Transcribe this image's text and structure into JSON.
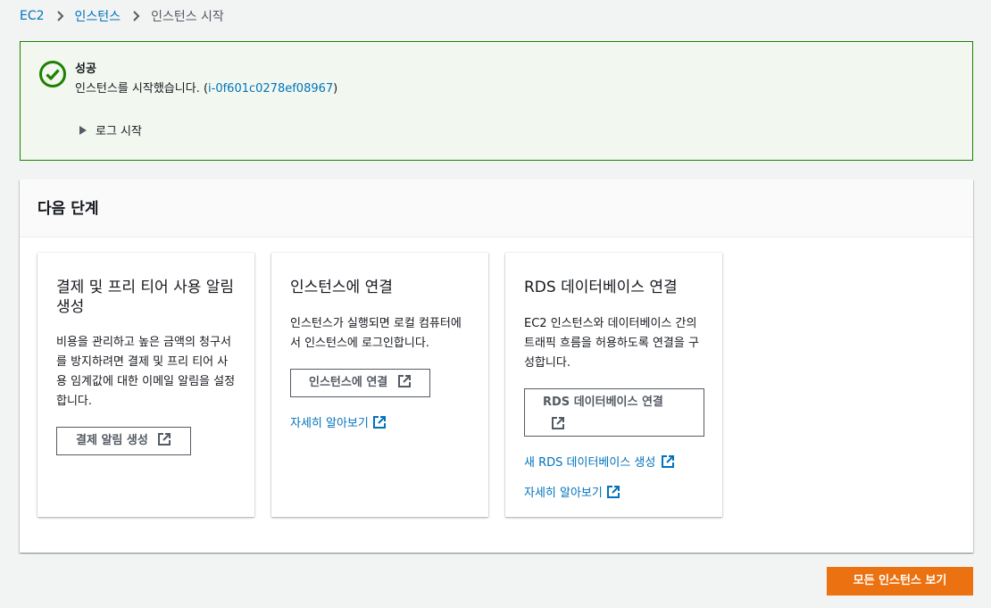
{
  "breadcrumb": {
    "items": [
      "EC2",
      "인스턴스"
    ],
    "current": "인스턴스 시작"
  },
  "alert": {
    "type": "success",
    "title": "성공",
    "message_prefix": "인스턴스를 시작했습니다. (",
    "instance_id": "i-0f601c0278ef08967",
    "message_suffix": ")",
    "log_toggle_label": "로그 시작",
    "colors": {
      "border": "#1d8102",
      "background": "#f2f8f0"
    }
  },
  "next_steps": {
    "title": "다음 단계",
    "cards": [
      {
        "title": "결제 및 프리 티어 사용 알림 생성",
        "description": "비용을 관리하고 높은 금액의 청구서를 방지하려면 결제 및 프리 티어 사용 임계값에 대한 이메일 알림을 설정합니다.",
        "button_label": "결제 알림 생성"
      },
      {
        "title": "인스턴스에 연결",
        "description": "인스턴스가 실행되면 로컬 컴퓨터에서 인스턴스에 로그인합니다.",
        "button_label": "인스턴스에 연결",
        "link_label": "자세히 알아보기"
      },
      {
        "title": "RDS 데이터베이스 연결",
        "description": "EC2 인스턴스와 데이터베이스 간의 트래픽 흐름을 허용하도록 연결을 구성합니다.",
        "button_label": "RDS 데이터베이스 연결",
        "link_create_label": "새 RDS 데이터베이스 생성",
        "link_learn_label": "자세히 알아보기"
      }
    ]
  },
  "footer": {
    "view_all_label": "모든 인스턴스 보기",
    "accent_color": "#ec7211"
  },
  "icons": {
    "success": "check-circle-icon",
    "external": "external-link-icon",
    "separator": "chevron-right-icon",
    "toggle": "caret-right-icon"
  },
  "link_color": "#0073bb"
}
